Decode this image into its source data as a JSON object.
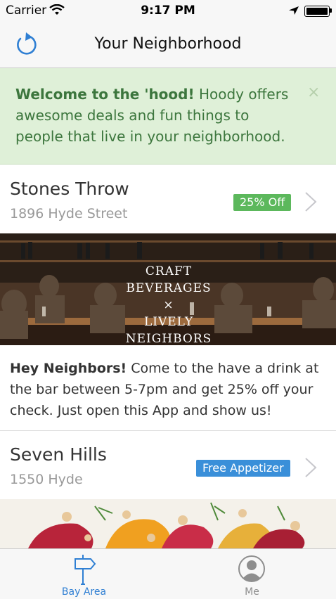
{
  "status_bar": {
    "carrier": "Carrier",
    "time": "9:17 PM"
  },
  "nav": {
    "title": "Your Neighborhood",
    "refresh_icon": "refresh-icon"
  },
  "welcome": {
    "bold": "Welcome to the 'hood!",
    "text": " Hoody offers awesome deals and fun things to people that live in your neighborhood.",
    "close": "×"
  },
  "listings": [
    {
      "name": "Stones Throw",
      "address": "1896 Hyde Street",
      "badge": "25% Off",
      "badge_color": "#5cb85c"
    },
    {
      "name": "Seven Hills",
      "address": "1550 Hyde",
      "badge": "Free Appetizer",
      "badge_color": "#3a8fd9"
    }
  ],
  "promo_image": {
    "line1": "CRAFT BEVERAGES",
    "sep": "×",
    "line2": "LIVELY NEIGHBORS"
  },
  "description": {
    "bold": "Hey Neighbors!",
    "text": " Come to the have a drink at the bar between 5-7pm and get 25% off your check. Just open this App and show us!"
  },
  "tabs": [
    {
      "label": "Bay Area",
      "icon": "signpost-icon",
      "active": true,
      "color": "#2f7fd3"
    },
    {
      "label": "Me",
      "icon": "user-icon",
      "active": false,
      "color": "#8e8e8e"
    }
  ],
  "colors": {
    "accent": "#2f7fd3",
    "welcome_bg": "#dff0d8",
    "welcome_text": "#3c763d"
  }
}
